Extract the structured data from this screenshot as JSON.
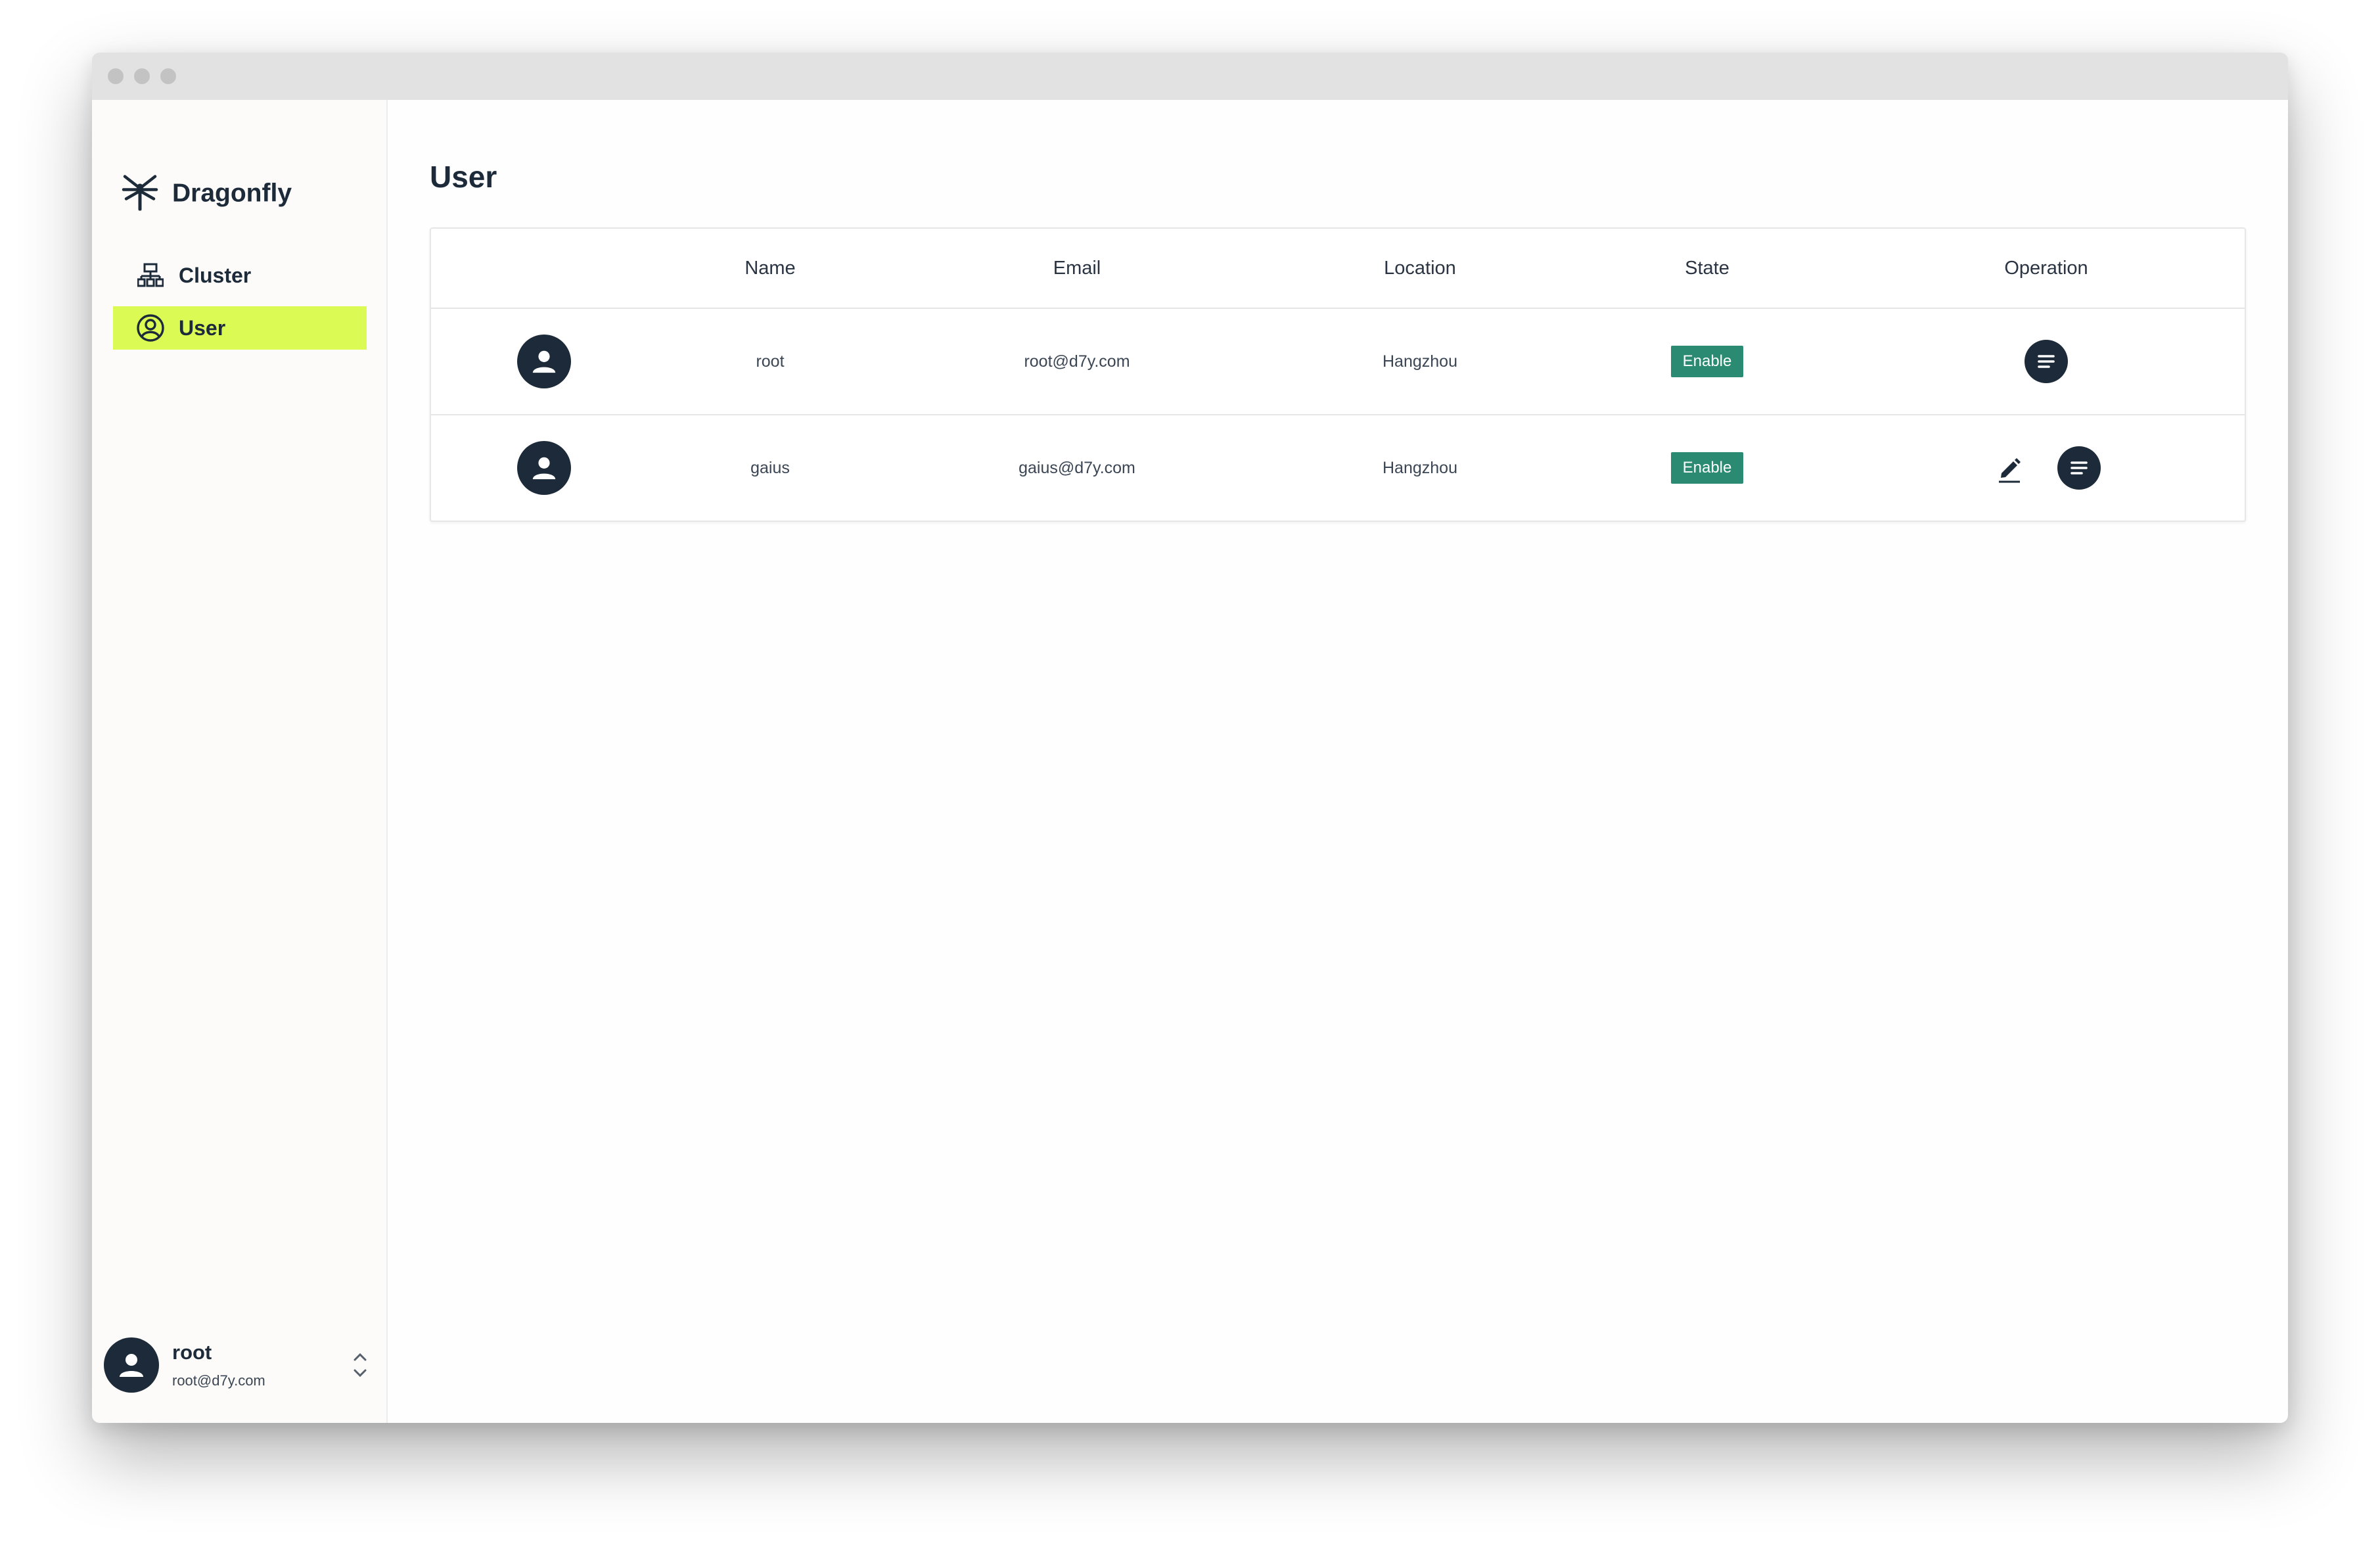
{
  "app": {
    "name": "Dragonfly",
    "logo_icon": "dragonfly-logo-icon"
  },
  "sidebar": {
    "items": [
      {
        "label": "Cluster",
        "icon": "cluster-icon",
        "active": false
      },
      {
        "label": "User",
        "icon": "user-circle-icon",
        "active": true
      }
    ],
    "account": {
      "name": "root",
      "email": "root@d7y.com",
      "icon": "unfold-chevron-icon"
    }
  },
  "page": {
    "title": "User"
  },
  "table": {
    "headers": [
      "",
      "Name",
      "Email",
      "Location",
      "State",
      "Operation"
    ],
    "rows": [
      {
        "name": "root",
        "email": "root@d7y.com",
        "location": "Hangzhou",
        "state": "Enable",
        "operations": [
          "detail"
        ]
      },
      {
        "name": "gaius",
        "email": "gaius@d7y.com",
        "location": "Hangzhou",
        "state": "Enable",
        "operations": [
          "edit",
          "detail"
        ]
      }
    ]
  },
  "colors": {
    "accent": "#dcfa54",
    "badge": "#2a8a72",
    "dark": "#1c2a39"
  }
}
